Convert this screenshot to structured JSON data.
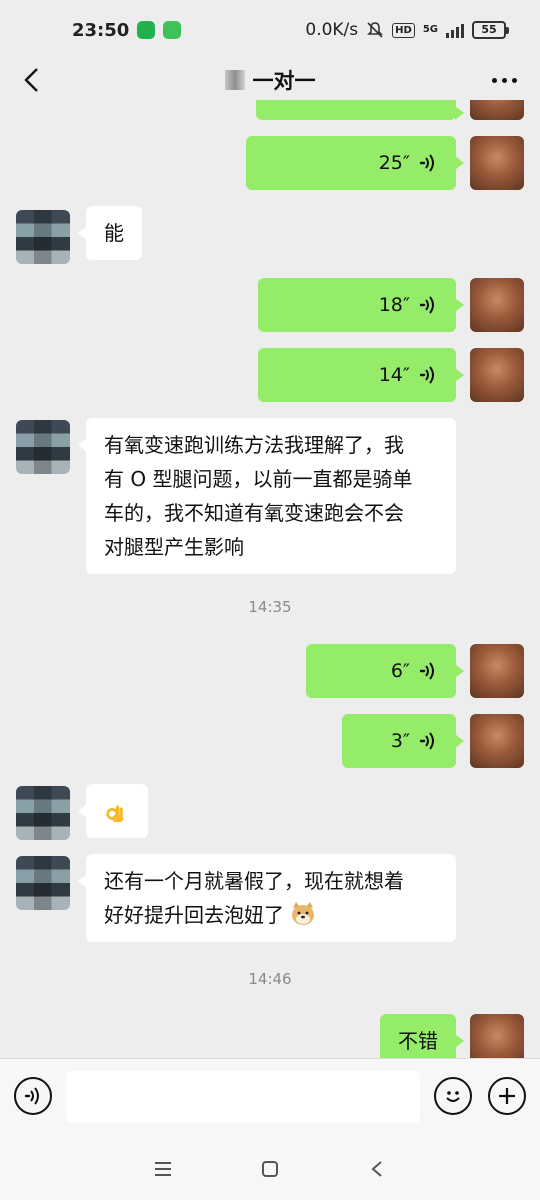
{
  "status_bar": {
    "time": "23:50",
    "net_speed": "0.0K/s",
    "hd": "HD",
    "network": "5G",
    "battery": "55"
  },
  "header": {
    "title": "一对一"
  },
  "messages": {
    "m1": {
      "duration": "25″"
    },
    "m2": {
      "text": "能"
    },
    "m3": {
      "duration": "18″"
    },
    "m4": {
      "duration": "14″"
    },
    "m5": {
      "lines": [
        "有氧变速跑训练方法我理解了，我",
        "有 O 型腿问题，以前一直都是骑单",
        "车的，我不知道有氧变速跑会不会",
        "对腿型产生影响"
      ]
    },
    "t1": "14:35",
    "m6": {
      "duration": "6″"
    },
    "m7": {
      "duration": "3″"
    },
    "m8": {
      "emoji": "ok-hand"
    },
    "m9": {
      "lines": [
        "还有一个月就暑假了，现在就想着",
        "好好提升回去泡妞了"
      ]
    },
    "t2": "14:46",
    "m10": {
      "text": "不错"
    }
  },
  "colors": {
    "my_bubble": "#95ec69",
    "their_bubble": "#ffffff",
    "background": "#ededed"
  },
  "icons": {
    "back": "chevron-left-icon",
    "more": "more-dots-icon",
    "voice_toggle": "voice-icon",
    "emoji": "emoji-icon",
    "plus": "plus-icon"
  }
}
